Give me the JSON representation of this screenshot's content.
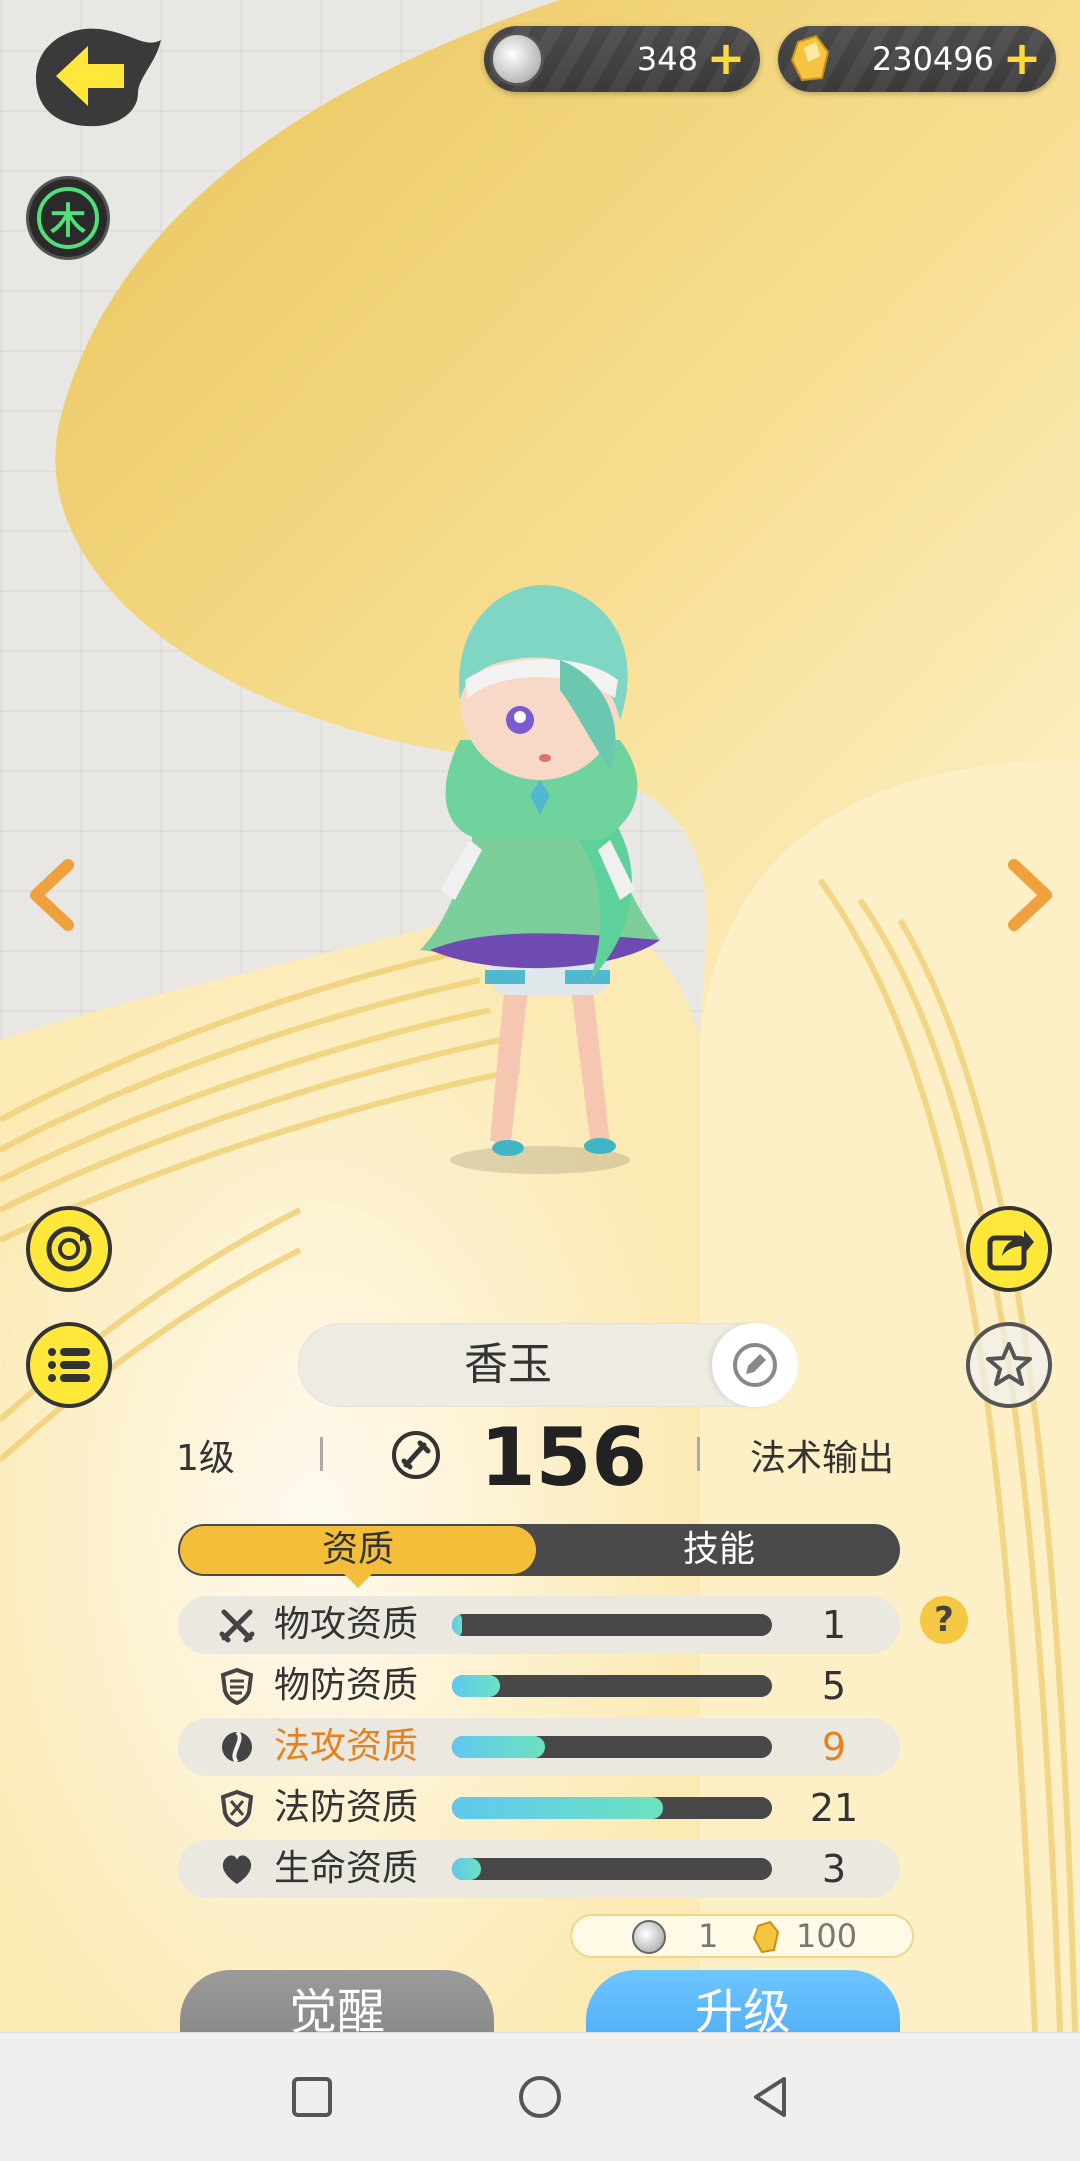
{
  "header": {
    "back_label": "",
    "element": "木",
    "currencies": [
      {
        "name": "pearl",
        "value": "348",
        "icon": "pearl-icon"
      },
      {
        "name": "crystal",
        "value": "230496",
        "icon": "crystal-icon"
      }
    ],
    "add_symbol": "+"
  },
  "character": {
    "name": "香玉",
    "level": "1级",
    "power": "156",
    "role": "法术输出"
  },
  "tabs": [
    {
      "label": "资质",
      "active": true
    },
    {
      "label": "技能",
      "active": false
    }
  ],
  "attributes": [
    {
      "label": "物攻资质",
      "value": "1",
      "fill": 0.03,
      "icon": "swords-icon",
      "highlight": false
    },
    {
      "label": "物防资质",
      "value": "5",
      "fill": 0.15,
      "icon": "shield-icon",
      "highlight": false
    },
    {
      "label": "法攻资质",
      "value": "9",
      "fill": 0.29,
      "icon": "magic-orb-icon",
      "highlight": true
    },
    {
      "label": "法防资质",
      "value": "21",
      "fill": 0.66,
      "icon": "magic-shield-icon",
      "highlight": false
    },
    {
      "label": "生命资质",
      "value": "3",
      "fill": 0.09,
      "icon": "heart-icon",
      "highlight": false
    }
  ],
  "help_label": "?",
  "cost": {
    "pearl": "1",
    "crystal": "100"
  },
  "buttons": {
    "awaken": "觉醒",
    "upgrade": "升级"
  },
  "colors": {
    "accent": "#f4be3a",
    "highlight": "#e6821c",
    "upgrade": "#3c9eef",
    "element": "#4fe07a"
  }
}
